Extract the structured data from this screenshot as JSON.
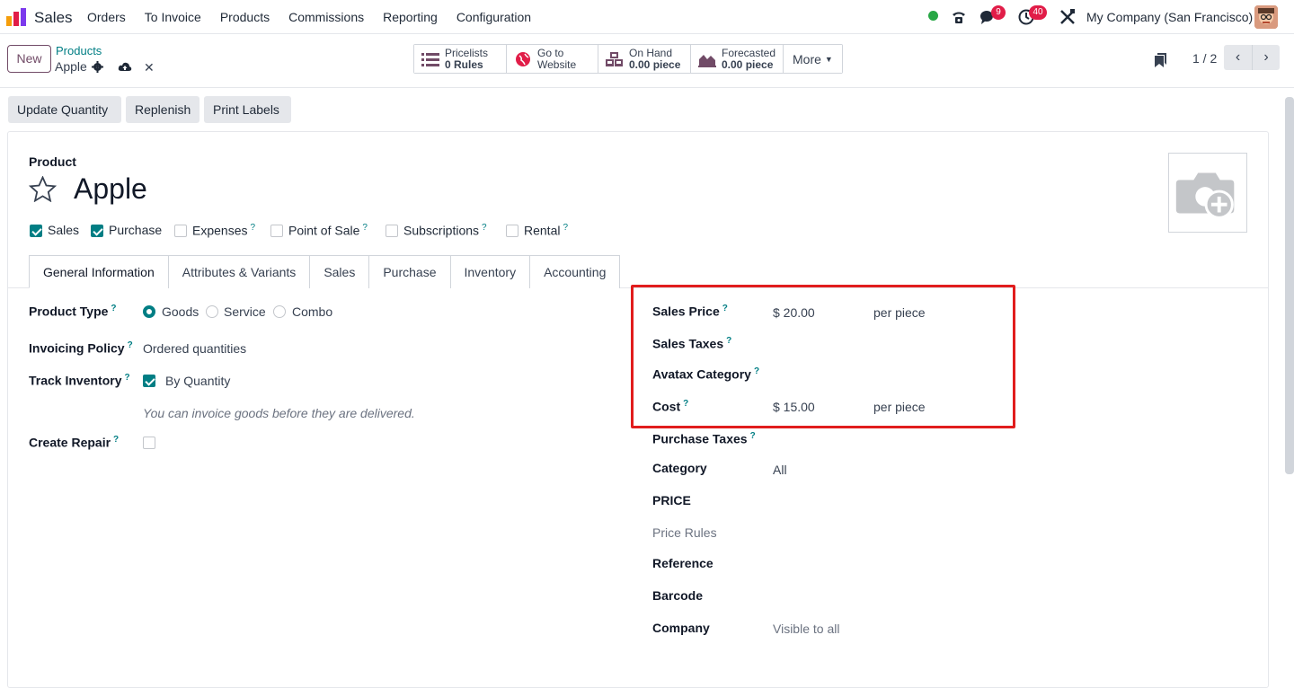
{
  "navbar": {
    "app_name": "Sales",
    "menu": [
      "Orders",
      "To Invoice",
      "Products",
      "Commissions",
      "Reporting",
      "Configuration"
    ],
    "chat_count": "9",
    "activity_count": "40",
    "company": "My Company (San Francisco)"
  },
  "control_panel": {
    "new_label": "New",
    "breadcrumb_parent": "Products",
    "record_name": "Apple",
    "stat_buttons": [
      {
        "icon": "list-icon",
        "line1": "Pricelists",
        "line2": "0 Rules"
      },
      {
        "icon": "globe-icon",
        "line1": "Go to",
        "line2": "Website"
      },
      {
        "icon": "cubes-icon",
        "line1": "On Hand",
        "line2": "0.00 piece"
      },
      {
        "icon": "area-chart-icon",
        "line1": "Forecasted",
        "line2": "0.00 piece"
      }
    ],
    "more_label": "More",
    "pager": "1 / 2"
  },
  "actions": {
    "update_quantity": "Update Quantity",
    "replenish": "Replenish",
    "print_labels": "Print Labels"
  },
  "form": {
    "product_label": "Product",
    "product_name": "Apple",
    "options": [
      {
        "label": "Sales",
        "checked": true,
        "help": false
      },
      {
        "label": "Purchase",
        "checked": true,
        "help": false
      },
      {
        "label": "Expenses",
        "checked": false,
        "help": true
      },
      {
        "label": "Point of Sale",
        "checked": false,
        "help": true
      },
      {
        "label": "Subscriptions",
        "checked": false,
        "help": true
      },
      {
        "label": "Rental",
        "checked": false,
        "help": true
      }
    ],
    "tabs": [
      "General Information",
      "Attributes & Variants",
      "Sales",
      "Purchase",
      "Inventory",
      "Accounting"
    ],
    "left": {
      "product_type_label": "Product Type",
      "product_type_options": [
        "Goods",
        "Service",
        "Combo"
      ],
      "product_type_selected": "Goods",
      "invoicing_policy_label": "Invoicing Policy",
      "invoicing_policy_value": "Ordered quantities",
      "track_inventory_label": "Track Inventory",
      "track_inventory_value": "By Quantity",
      "hint": "You can invoice goods before they are delivered.",
      "create_repair_label": "Create Repair"
    },
    "right": {
      "sales_price_label": "Sales Price",
      "sales_price_value": "$ 20.00",
      "sales_price_unit": "per piece",
      "sales_taxes_label": "Sales Taxes",
      "avatax_label": "Avatax Category",
      "cost_label": "Cost",
      "cost_value": "$ 15.00",
      "cost_unit": "per piece",
      "purchase_taxes_label": "Purchase Taxes",
      "category_label": "Category",
      "category_value": "All",
      "price_section": "PRICE",
      "price_rules": "Price Rules",
      "reference_label": "Reference",
      "barcode_label": "Barcode",
      "company_label": "Company",
      "company_placeholder": "Visible to all"
    }
  },
  "colors": {
    "accent": "#017e84",
    "brand": "#714b67",
    "highlight": "#e11d1d",
    "badge": "#e11d48"
  }
}
